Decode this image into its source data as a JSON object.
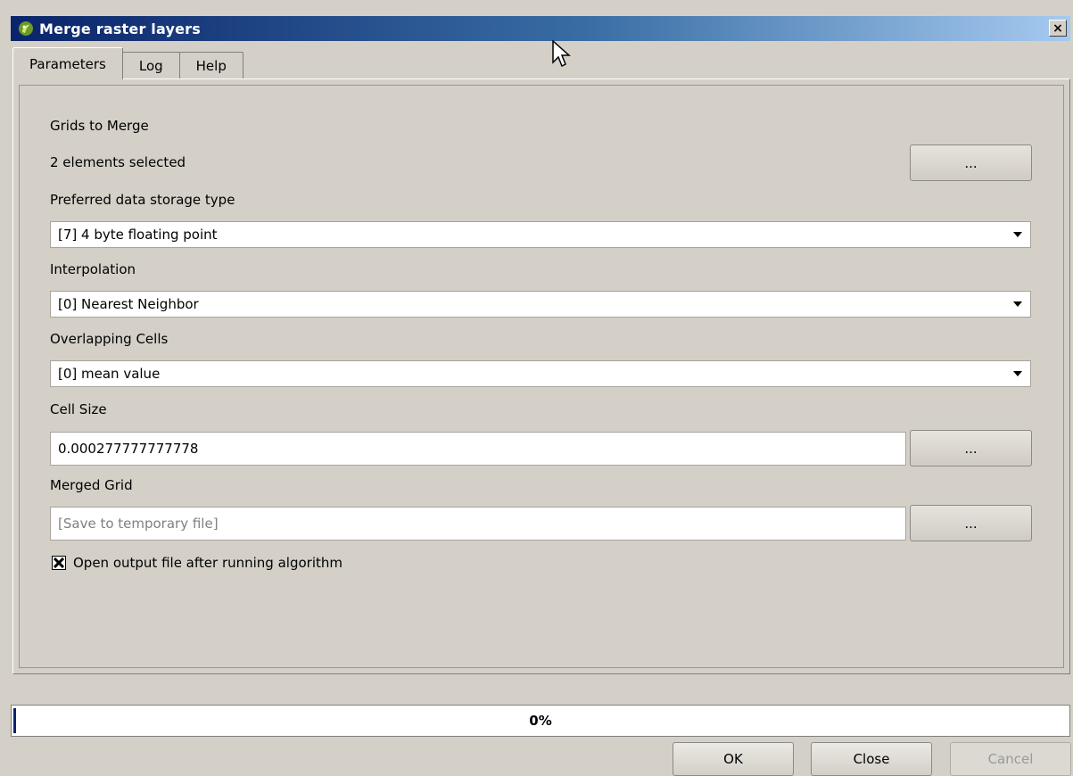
{
  "window": {
    "title": "Merge raster layers",
    "close_label": "×",
    "title_gradient": [
      "#0a246a",
      "#3a6ea5",
      "#a6caf0"
    ]
  },
  "tabs": [
    {
      "label": "Parameters",
      "active": true
    },
    {
      "label": "Log",
      "active": false
    },
    {
      "label": "Help",
      "active": false
    }
  ],
  "params": {
    "grids_to_merge": {
      "label": "Grids to Merge",
      "value": "2 elements selected",
      "button": "..."
    },
    "storage_type": {
      "label": "Preferred data storage type",
      "value": "[7] 4 byte floating point"
    },
    "interpolation": {
      "label": "Interpolation",
      "value": "[0] Nearest Neighbor"
    },
    "overlapping": {
      "label": "Overlapping Cells",
      "value": "[0] mean value"
    },
    "cell_size": {
      "label": "Cell Size",
      "value": "0.000277777777778",
      "button": "..."
    },
    "merged_grid": {
      "label": "Merged Grid",
      "placeholder": "[Save to temporary file]",
      "button": "..."
    },
    "open_output": {
      "label": "Open output file after running algorithm",
      "checked": true
    }
  },
  "progress": {
    "text": "0%",
    "value": 0
  },
  "buttons": {
    "ok": "OK",
    "close": "Close",
    "cancel": "Cancel"
  }
}
